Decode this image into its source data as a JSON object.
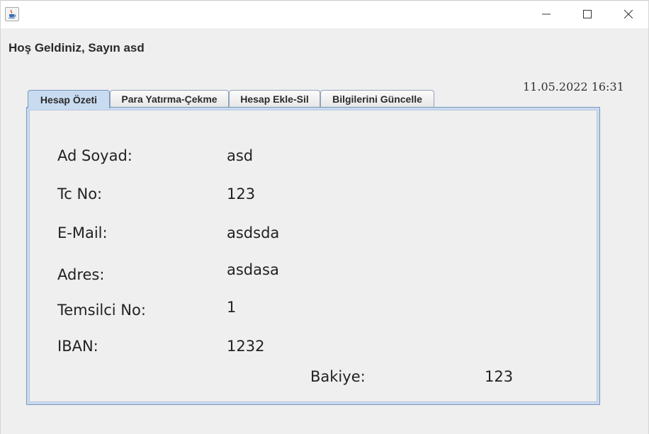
{
  "window": {
    "app_icon": "java-cup-icon",
    "controls": [
      "minimize-icon",
      "maximize-icon",
      "close-icon"
    ]
  },
  "header": {
    "welcome": "Hoş Geldiniz, Sayın asd",
    "datetime": "11.05.2022 16:31"
  },
  "tabs": [
    {
      "label": "Hesap Özeti",
      "active": true
    },
    {
      "label": "Para Yatırma-Çekme",
      "active": false
    },
    {
      "label": "Hesap Ekle-Sil",
      "active": false
    },
    {
      "label": "Bilgilerini Güncelle",
      "active": false
    }
  ],
  "summary": {
    "rows": [
      {
        "label": "Ad Soyad:",
        "value": "asd"
      },
      {
        "label": "Tc No:",
        "value": "123"
      },
      {
        "label": "E-Mail:",
        "value": "asdsda"
      },
      {
        "label": "Adres:",
        "value": "asdasa"
      },
      {
        "label": "Temsilci No:",
        "value": "1"
      },
      {
        "label": "IBAN:",
        "value": "1232"
      }
    ],
    "balance_label": "Bakiye:",
    "balance_value": "123"
  },
  "colors": {
    "tab_active": "#c8dbf0",
    "panel_border": "#7a97bd",
    "background": "#efefef"
  }
}
